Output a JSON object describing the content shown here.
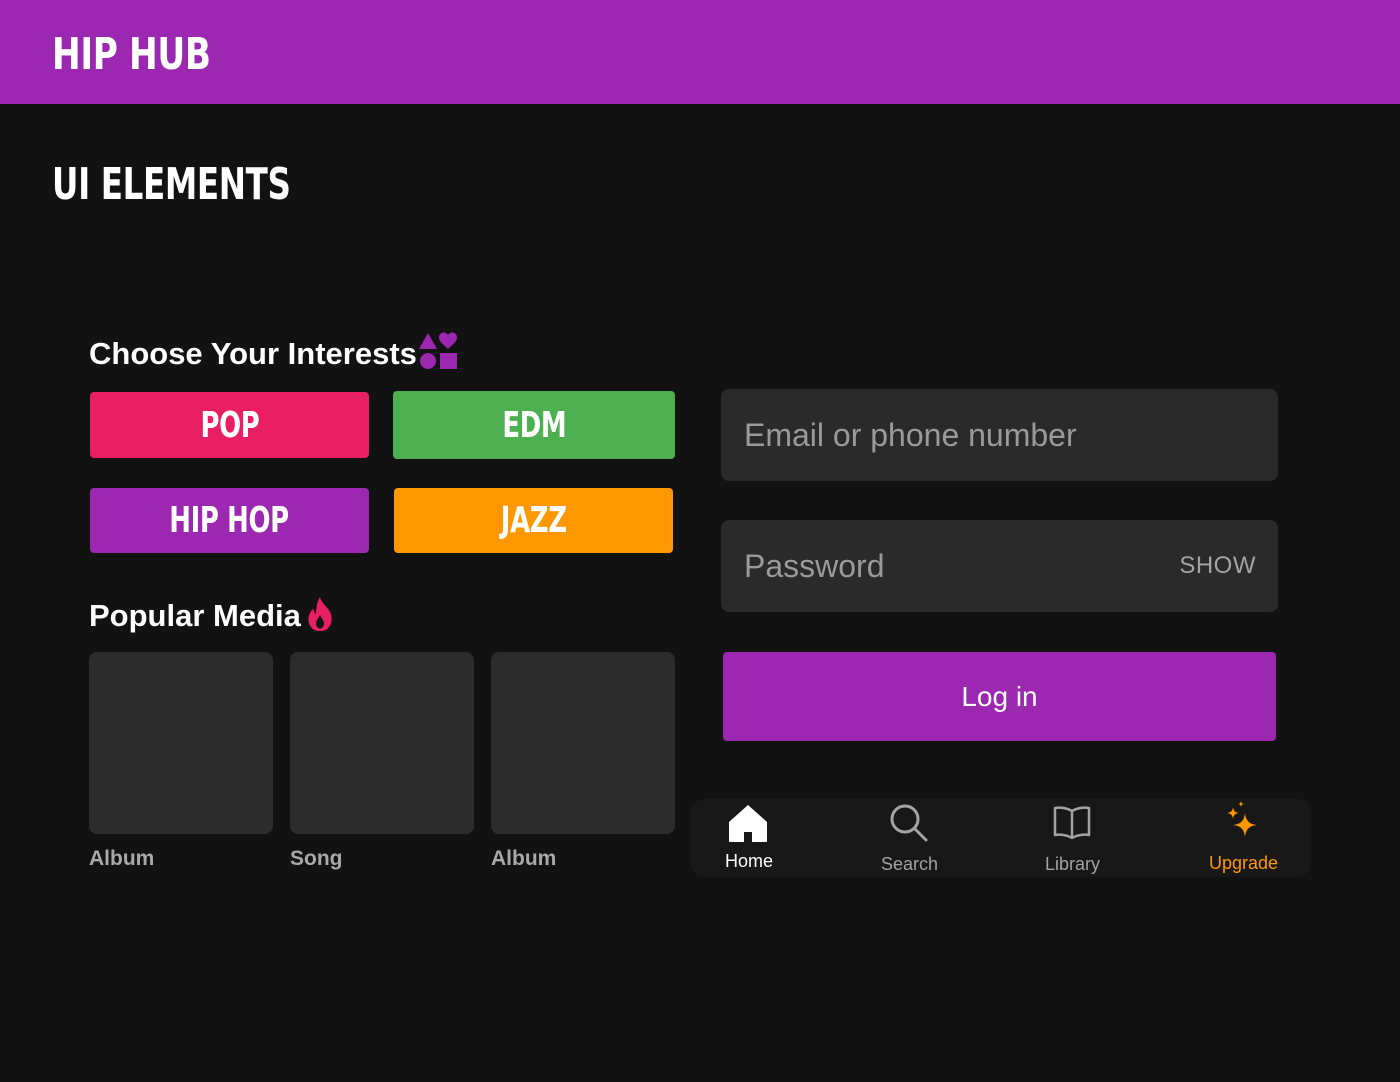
{
  "header": {
    "brand": "HIP HUB"
  },
  "page": {
    "title": "UI ELEMENTS"
  },
  "interests": {
    "heading": "Choose Your Interests",
    "icon": "shapes-icon",
    "chips": [
      {
        "label": "POP",
        "color": "#e91e63"
      },
      {
        "label": "EDM",
        "color": "#4caf50"
      },
      {
        "label": "HIP HOP",
        "color": "#9c27b0"
      },
      {
        "label": "JAZZ",
        "color": "#ff9800"
      }
    ]
  },
  "popular_media": {
    "heading": "Popular Media",
    "icon": "fire-icon",
    "items": [
      {
        "label": "Album"
      },
      {
        "label": "Song"
      },
      {
        "label": "Album"
      }
    ]
  },
  "login": {
    "email_placeholder": "Email or phone number",
    "password_placeholder": "Password",
    "show_label": "SHOW",
    "button_label": "Log in"
  },
  "nav": {
    "items": [
      {
        "label": "Home",
        "icon": "home-icon",
        "active": true,
        "color": "#ffffff"
      },
      {
        "label": "Search",
        "icon": "search-icon",
        "active": false,
        "color": "#a3a3a3"
      },
      {
        "label": "Library",
        "icon": "library-icon",
        "active": false,
        "color": "#a3a3a3"
      },
      {
        "label": "Upgrade",
        "icon": "sparkle-icon",
        "active": false,
        "color": "#ff9800"
      }
    ]
  },
  "colors": {
    "primary": "#9c27b0",
    "background": "#121212",
    "surface": "#2a2a2a",
    "accent_pink": "#e91e63",
    "accent_orange": "#ff9800"
  }
}
